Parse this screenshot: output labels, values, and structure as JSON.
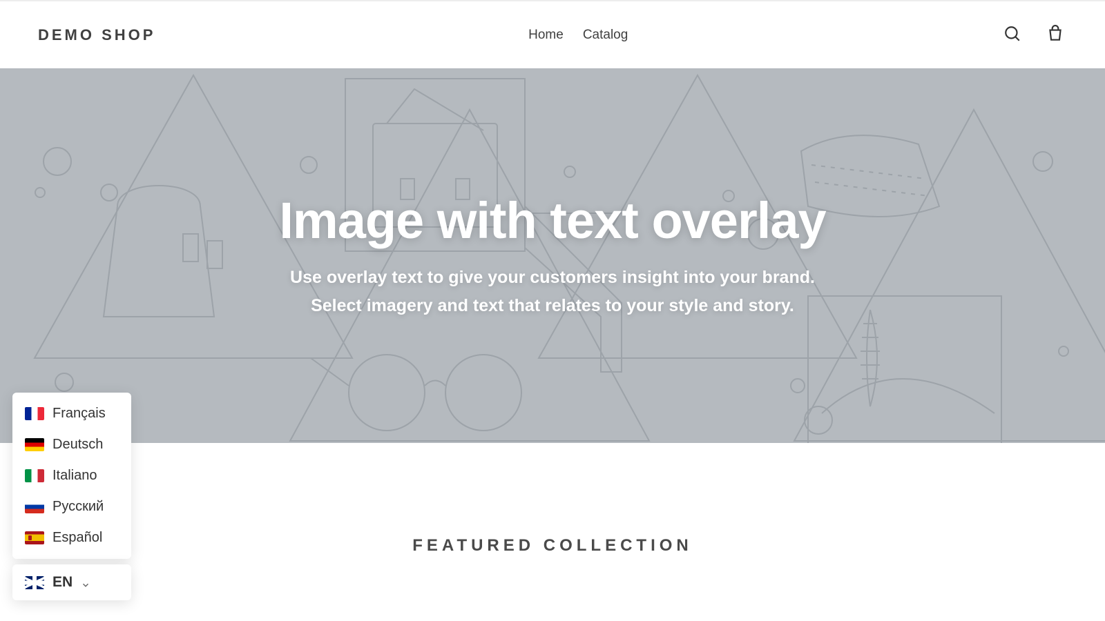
{
  "header": {
    "logo": "DEMO SHOP",
    "nav": {
      "home": "Home",
      "catalog": "Catalog"
    },
    "icons": {
      "search": "search-icon",
      "cart": "cart-icon"
    }
  },
  "hero": {
    "title": "Image with text overlay",
    "subtitle_line1": "Use overlay text to give your customers insight into your brand.",
    "subtitle_line2": "Select imagery and text that relates to your style and story."
  },
  "section": {
    "featured_title": "FEATURED COLLECTION"
  },
  "language_menu": {
    "options": [
      {
        "code": "fr",
        "label": "Français"
      },
      {
        "code": "de",
        "label": "Deutsch"
      },
      {
        "code": "it",
        "label": "Italiano"
      },
      {
        "code": "ru",
        "label": "Русский"
      },
      {
        "code": "es",
        "label": "Español"
      }
    ],
    "current": {
      "code": "en",
      "label": "EN"
    }
  },
  "colors": {
    "hero_bg": "#b5babf",
    "text_dark": "#404040"
  }
}
